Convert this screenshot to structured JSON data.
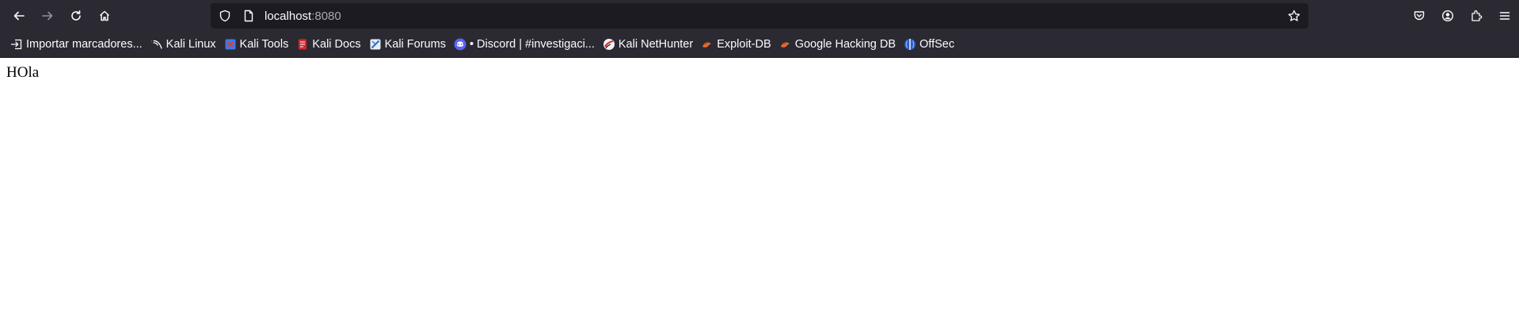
{
  "toolbar": {
    "url_host": "localhost",
    "url_port": ":8080",
    "icons": [
      "back-icon",
      "forward-icon",
      "reload-icon",
      "home-icon",
      "shield-icon",
      "page-icon",
      "star-icon",
      "pocket-icon",
      "account-icon",
      "extensions-icon",
      "menu-icon"
    ]
  },
  "bookmarks": [
    {
      "label": "Importar marcadores...",
      "icon": "import-icon"
    },
    {
      "label": "Kali Linux",
      "icon": "kali-dragon-icon"
    },
    {
      "label": "Kali Tools",
      "icon": "kali-tools-icon"
    },
    {
      "label": "Kali Docs",
      "icon": "kali-docs-icon"
    },
    {
      "label": "Kali Forums",
      "icon": "kali-forums-icon"
    },
    {
      "label": "• Discord | #investigaci...",
      "icon": "discord-icon"
    },
    {
      "label": "Kali NetHunter",
      "icon": "nethunter-icon"
    },
    {
      "label": "Exploit-DB",
      "icon": "exploit-db-icon"
    },
    {
      "label": "Google Hacking DB",
      "icon": "ghdb-icon"
    },
    {
      "label": "OffSec",
      "icon": "offsec-icon"
    }
  ],
  "page": {
    "body_text": "HOla"
  },
  "colors": {
    "chrome": "#2b2a33",
    "urlbar": "#1c1b22",
    "text": "#fbfbfe"
  }
}
